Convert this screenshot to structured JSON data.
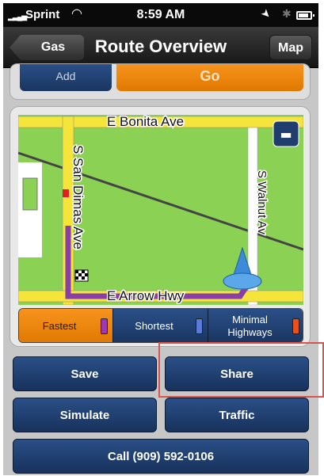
{
  "status_bar": {
    "carrier": "Sprint",
    "time": "8:59 AM"
  },
  "nav": {
    "back_label": "Gas",
    "title": "Route Overview",
    "map_label": "Map"
  },
  "top_buttons": {
    "add": "Add",
    "go": "Go"
  },
  "map": {
    "streets": {
      "north": "E Bonita Ave",
      "west": "S San Dimas Ave",
      "east": "S Walnut Av",
      "south": "E Arrow Hwy"
    },
    "route_color": "#8a3ea8",
    "road_color": "#f5e43a",
    "land_color": "#8bd254"
  },
  "route_options": [
    {
      "label": "Fastest",
      "color": "#9b39b5"
    },
    {
      "label": "Shortest",
      "color": "#5b7bd6"
    },
    {
      "label": "Minimal Highways",
      "color": "#e8501d"
    }
  ],
  "actions": {
    "save": "Save",
    "share": "Share",
    "simulate": "Simulate",
    "traffic": "Traffic",
    "call": "Call (909) 592-0106"
  },
  "colors": {
    "accent_orange": "#f7941d",
    "button_blue": "#2a4f87",
    "highlight": "#d9534f"
  }
}
